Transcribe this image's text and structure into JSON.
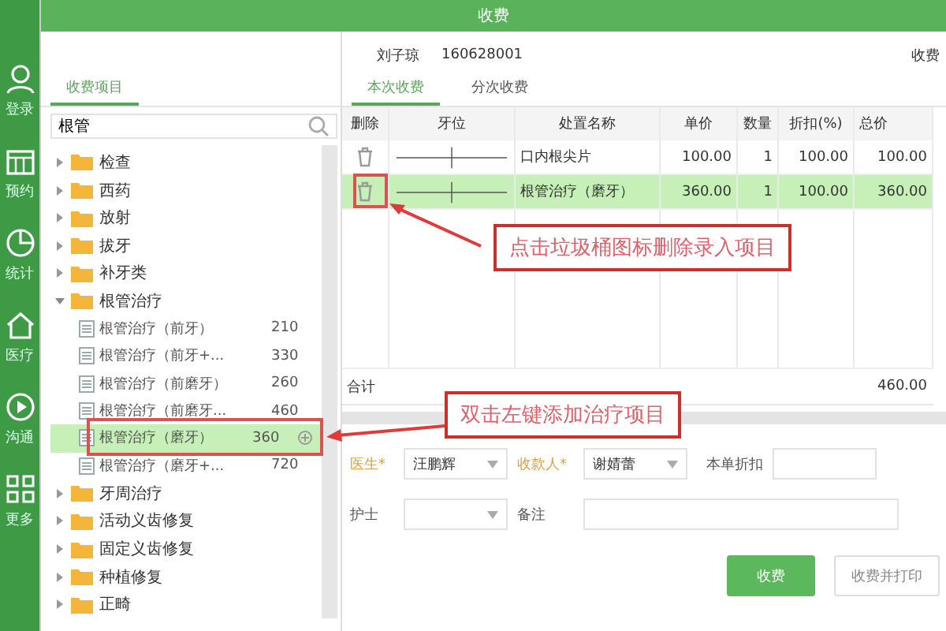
{
  "app_sidebar": {
    "items": [
      {
        "label": "登录"
      },
      {
        "label": "预约"
      },
      {
        "label": "统计"
      },
      {
        "label": "医疗"
      },
      {
        "label": "沟通"
      },
      {
        "label": "更多"
      }
    ]
  },
  "dialog": {
    "title": "收费",
    "patient_name": "刘子琼",
    "patient_id": "160628001",
    "charge_time_label": "收费"
  },
  "items_panel": {
    "tabs": [
      {
        "label": "收费项目",
        "selected": true
      }
    ],
    "search": {
      "value": "根管"
    },
    "tree": [
      {
        "label": "检查",
        "expanded": false
      },
      {
        "label": "西药",
        "expanded": false
      },
      {
        "label": "放射",
        "expanded": false
      },
      {
        "label": "拔牙",
        "expanded": false
      },
      {
        "label": "补牙类",
        "expanded": false
      },
      {
        "label": "根管治疗",
        "expanded": true,
        "children": [
          {
            "label": "根管治疗（前牙）",
            "price": "210",
            "selected": false
          },
          {
            "label": "根管治疗（前牙+...",
            "price": "330",
            "selected": false
          },
          {
            "label": "根管治疗（前磨牙）",
            "price": "260",
            "selected": false
          },
          {
            "label": "根管治疗（前磨牙...",
            "price": "460",
            "selected": false
          },
          {
            "label": "根管治疗（磨牙）",
            "price": "360",
            "selected": true
          },
          {
            "label": "根管治疗（磨牙+...",
            "price": "720",
            "selected": false
          }
        ]
      },
      {
        "label": "牙周治疗",
        "expanded": false
      },
      {
        "label": "活动义齿修复",
        "expanded": false
      },
      {
        "label": "固定义齿修复",
        "expanded": false
      },
      {
        "label": "种植修复",
        "expanded": false
      },
      {
        "label": "正畸",
        "expanded": false
      }
    ]
  },
  "charge_panel": {
    "tabs": [
      {
        "label": "本次收费",
        "selected": true
      },
      {
        "label": "分次收费",
        "selected": false
      }
    ],
    "columns": [
      "删除",
      "牙位",
      "处置名称",
      "单价",
      "数量",
      "折扣(%)",
      "总价"
    ],
    "rows": [
      {
        "name": "口内根尖片",
        "unit_price": "100.00",
        "quantity": "1",
        "discount": "100.00",
        "total": "100.00",
        "selected": false
      },
      {
        "name": "根管治疗（磨牙）",
        "unit_price": "360.00",
        "quantity": "1",
        "discount": "100.00",
        "total": "360.00",
        "selected": true
      }
    ],
    "total_label": "合计",
    "total": "460.00"
  },
  "form": {
    "doctor": {
      "label": "医生*",
      "value": "汪鹏辉"
    },
    "payee": {
      "label": "收款人*",
      "value": "谢婧蕾"
    },
    "discount": {
      "label": "本单折扣"
    },
    "nurse": {
      "label": "护士"
    },
    "remark": {
      "label": "备注"
    }
  },
  "buttons": [
    {
      "label": "收费",
      "kind": "primary"
    },
    {
      "label": "收费并打印",
      "kind": "secondary"
    }
  ],
  "annotations": [
    {
      "text": "点击垃圾桶图标删除录入项目"
    },
    {
      "text": "双击左键添加治疗项目"
    }
  ]
}
